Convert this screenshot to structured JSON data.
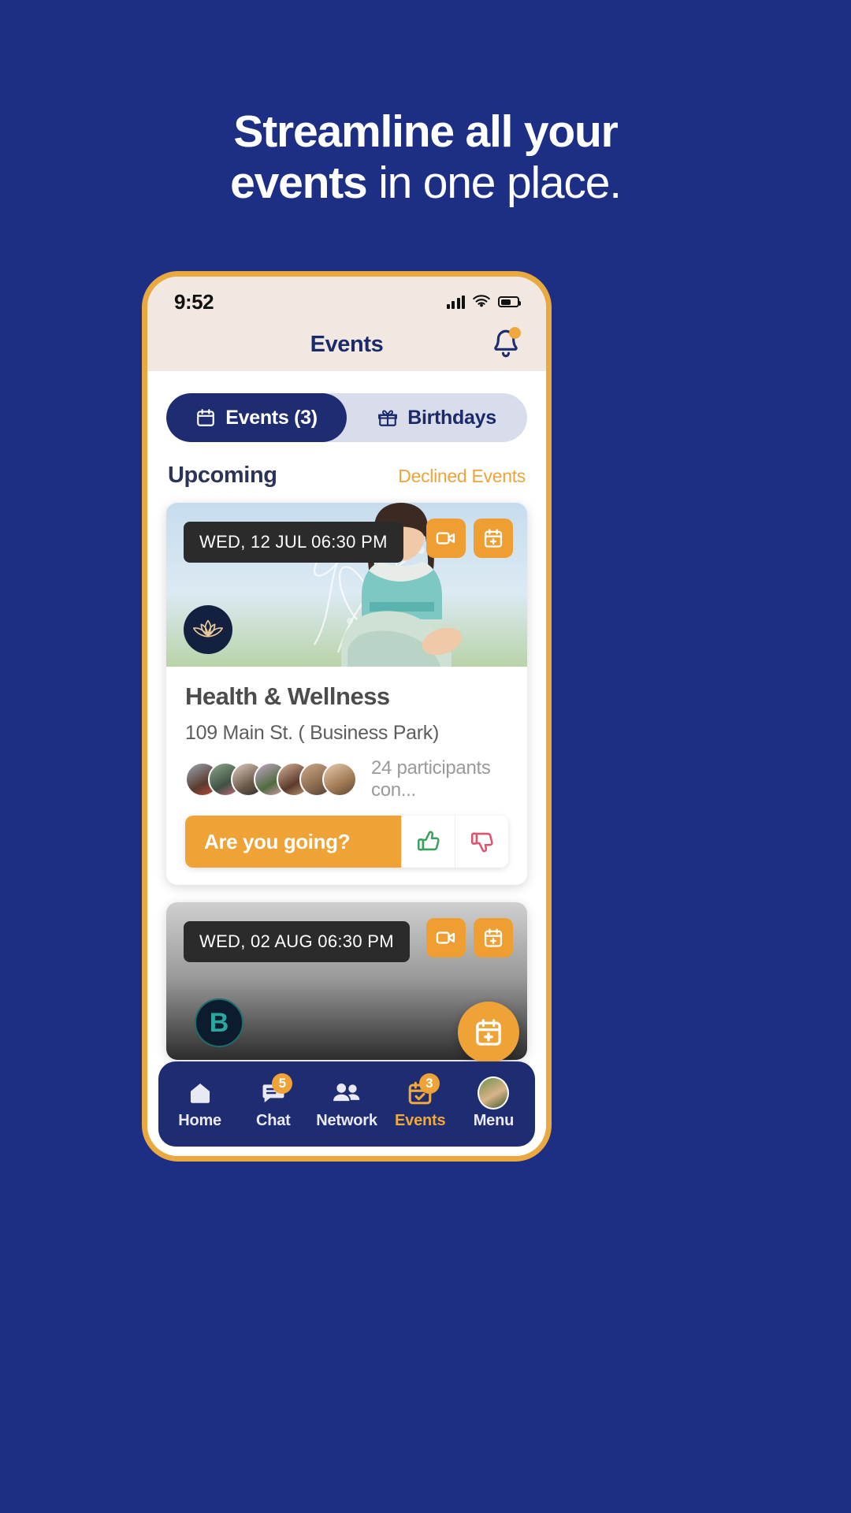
{
  "marketing": {
    "headline_line1_bold": "Streamline all your",
    "headline_line2_bold": "events",
    "headline_line2_light": " in one place."
  },
  "colors": {
    "background": "#1d2f85",
    "phone_border": "#eaa93e",
    "statusbar_bg": "#f1e9e1",
    "navy": "#1e2d72",
    "orange": "#efa236",
    "link_orange": "#eda43a"
  },
  "statusbar": {
    "time": "9:52",
    "signal_icon": "signal-bars-icon",
    "wifi_icon": "wifi-icon",
    "battery_icon": "battery-icon"
  },
  "header": {
    "title": "Events",
    "bell_icon": "notification-bell-icon",
    "bell_has_badge": true
  },
  "tabs": [
    {
      "label": "Events (3)",
      "icon": "calendar-icon",
      "active": true
    },
    {
      "label": "Birthdays",
      "icon": "gift-icon",
      "active": false
    }
  ],
  "section": {
    "title": "Upcoming",
    "link": "Declined Events"
  },
  "events": [
    {
      "date_badge": "WED, 12 JUL 06:30 PM",
      "title": "Health & Wellness",
      "address": "109 Main St. ( Business Park)",
      "participants_text": "24 participants con...",
      "rsvp_prompt": "Are you going?",
      "video_icon": "video-camera-icon",
      "add_calendar_icon": "calendar-add-icon",
      "org_logo_icon": "lotus-flower-icon",
      "accept_icon": "thumbs-up-icon",
      "decline_icon": "thumbs-down-icon"
    },
    {
      "date_badge": "WED, 02 AUG 06:30 PM",
      "video_icon": "video-camera-icon",
      "add_calendar_icon": "calendar-add-icon",
      "org_logo_letter": "B"
    }
  ],
  "fab": {
    "icon": "calendar-add-icon"
  },
  "bottom_nav": [
    {
      "label": "Home",
      "icon": "home-icon",
      "badge": null,
      "active": false
    },
    {
      "label": "Chat",
      "icon": "chat-icon",
      "badge": "5",
      "active": false
    },
    {
      "label": "Network",
      "icon": "people-icon",
      "badge": null,
      "active": false
    },
    {
      "label": "Events",
      "icon": "calendar-check-icon",
      "badge": "3",
      "active": true
    },
    {
      "label": "Menu",
      "icon": "avatar-icon",
      "badge": null,
      "active": false
    }
  ]
}
